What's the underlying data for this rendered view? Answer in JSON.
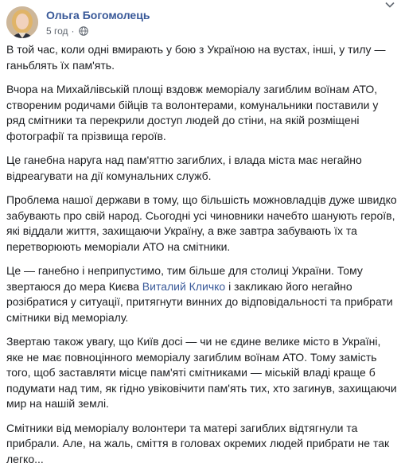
{
  "post": {
    "author": "Ольга Богомолець",
    "time": "5 год",
    "dot": "·",
    "paragraphs": [
      {
        "text": "В той час, коли одні вмирають у бою з Україною на вустах, інші, у тилу — ганьблять їх пам'ять."
      },
      {
        "text": "Вчора на Михайлівській площі вздовж меморіалу загиблим воїнам АТО, створеним родичами бійців та волонтерами, комунальники поставили у ряд смітники та перекрили доступ людей до стіни, на якій розміщені фотографії та прізвища героїв."
      },
      {
        "text": "Це ганебна наруга над пам'яттю загиблих, і влада міста має негайно відреагувати на дії комунальних служб."
      },
      {
        "text": "Проблема нашої держави в тому, що більшість можновладців дуже швидко забувають про свій народ. Сьогодні усі чиновники начебто шанують героїв, які віддали життя, захищаючи Україну, а вже завтра забувають їх та перетворюють меморіали АТО на смітники."
      },
      {
        "before": "Це — ганебно і неприпустимо, тим більше для столиці України. Тому звертаюся до мера Києва ",
        "mention": "Виталий Кличко",
        "after": " і закликаю його негайно розібратися у ситуації, притягнути винних до відповідальності та прибрати смітники від меморіалу."
      },
      {
        "text": "Звертаю також увагу, що Київ досі — чи не єдине велике місто в Україні, яке не має повноцінного меморіалу загиблим воїнам АТО. Тому замість того, щоб заставляти місце пам'яті смітниками — міській владі краще б подумати над тим, як гідно увіковічити пам'ять тих, хто загинув, захищаючи мир на нашій землі."
      },
      {
        "text": "Смітники від меморіалу волонтери та матері загиблих відтягнули та прибрали. Але, на жаль, сміття в головах окремих людей прибрати не так легко..."
      }
    ]
  },
  "icons": {
    "audience": "globe-icon",
    "options": "chevron-down-icon"
  },
  "colors": {
    "link": "#385898",
    "text": "#1c1e21",
    "meta": "#606770"
  }
}
